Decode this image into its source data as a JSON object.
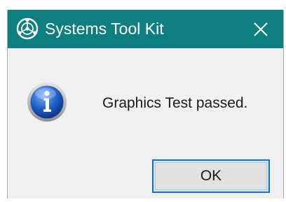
{
  "window": {
    "title": "Systems Tool Kit",
    "title_icon": "stk-globe-icon",
    "close_icon": "close-icon",
    "titlebar_color": "#0e7f80"
  },
  "body": {
    "icon": "information-icon",
    "message": "Graphics Test passed."
  },
  "buttons": {
    "ok_label": "OK"
  },
  "colors": {
    "dialog_bg": "#f0f0f0",
    "button_border": "#0a74d2",
    "info_blue": "#1f5fc4"
  }
}
